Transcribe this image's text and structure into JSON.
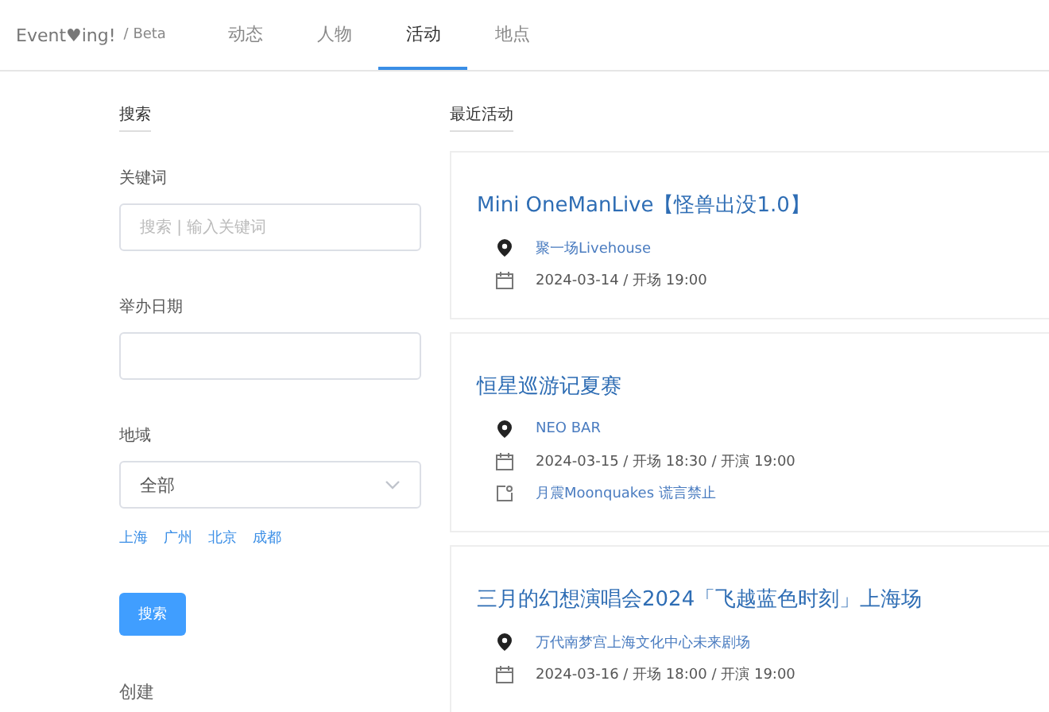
{
  "brand": {
    "name": "Event♥ing!",
    "suffix": "/ Beta"
  },
  "tabs": [
    {
      "label": "动态",
      "selected": false
    },
    {
      "label": "人物",
      "selected": false
    },
    {
      "label": "活动",
      "selected": true
    },
    {
      "label": "地点",
      "selected": false
    }
  ],
  "sidebar": {
    "heading": "搜索",
    "keyword_label": "关键词",
    "keyword_placeholder": "搜索 | 输入关键词",
    "date_label": "举办日期",
    "region_label": "地域",
    "region_value": "全部",
    "cities": [
      "上海",
      "广州",
      "北京",
      "成都"
    ],
    "search_button": "搜索",
    "create_heading": "创建"
  },
  "main": {
    "heading": "最近活动",
    "events": [
      {
        "title": "Mini OneManLive【怪兽出没1.0】",
        "details": [
          {
            "kind": "location",
            "text": "聚一场Livehouse"
          },
          {
            "kind": "date",
            "text": "2024-03-14 / 开场 19:00"
          }
        ]
      },
      {
        "title": "恒星巡游记夏赛",
        "details": [
          {
            "kind": "location",
            "text": "NEO BAR"
          },
          {
            "kind": "date",
            "text": "2024-03-15 / 开场 18:30 / 开演 19:00"
          },
          {
            "kind": "artist",
            "text": "月震Moonquakes 谎言禁止"
          }
        ]
      },
      {
        "title": "三月的幻想演唱会2024「飞越蓝色时刻」上海场",
        "details": [
          {
            "kind": "location",
            "text": "万代南梦宫上海文化中心未来剧场"
          },
          {
            "kind": "date",
            "text": "2024-03-16 / 开场 18:00 / 开演 19:00"
          }
        ]
      }
    ]
  }
}
